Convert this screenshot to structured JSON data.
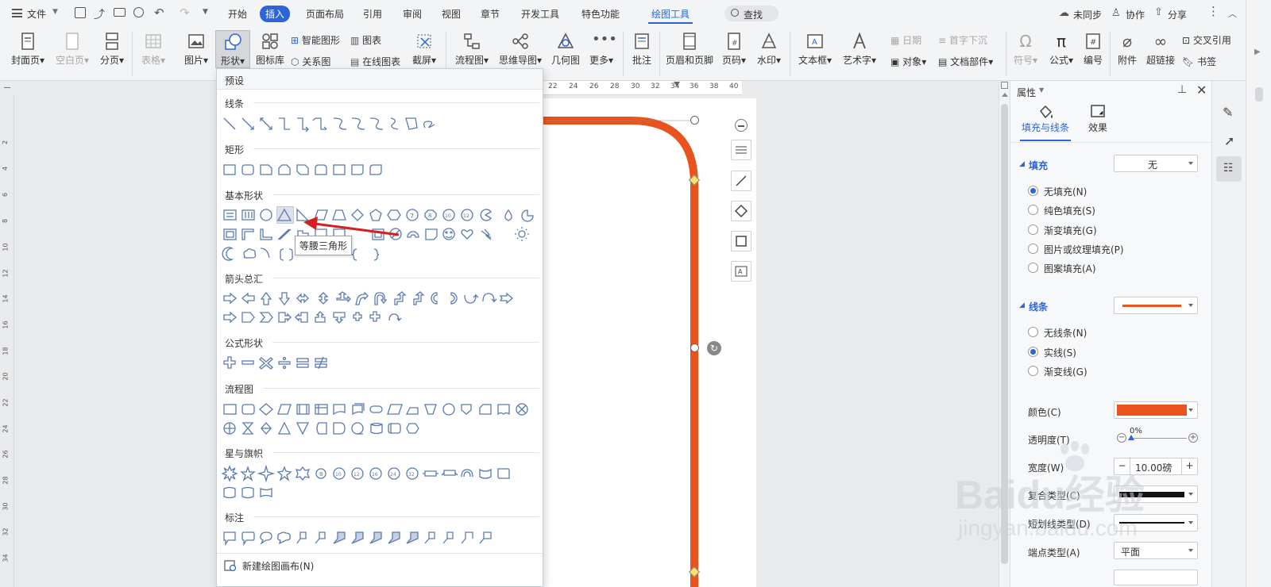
{
  "menubar": {
    "file": "文件",
    "tabs": [
      "开始",
      "插入",
      "页面布局",
      "引用",
      "审阅",
      "视图",
      "章节",
      "开发工具",
      "特色功能",
      "绘图工具"
    ],
    "active_tab": "插入",
    "search": "查找",
    "sync": "未同步",
    "collab": "协作",
    "share": "分享"
  },
  "ribbon": {
    "cover": "封面页",
    "blank": "空白页",
    "pagebreak": "分页",
    "table": "表格",
    "picture": "图片",
    "shape": "形状",
    "iconlib": "图标库",
    "smartart": "智能图形",
    "chart": "图表",
    "relation": "关系图",
    "onlinechart": "在线图表",
    "screenshot": "截屏",
    "flowchart": "流程图",
    "mindmap": "思维导图",
    "geometry": "几何图",
    "more": "更多",
    "comment": "批注",
    "headerfooter": "页眉和页脚",
    "pagenum": "页码",
    "watermark": "水印",
    "textbox": "文本框",
    "wordart": "艺术字",
    "date": "日期",
    "dropcap": "首字下沉",
    "object": "对象",
    "docparts": "文档部件",
    "symbol": "符号",
    "formula": "公式",
    "numbering": "编号",
    "attachment": "附件",
    "hyperlink": "超链接",
    "crossref": "交叉引用",
    "bookmark": "书签"
  },
  "ruler": {
    "ticks": [
      "22",
      "24",
      "26",
      "28",
      "30",
      "32",
      "34",
      "36",
      "38",
      "40"
    ],
    "left_ticks": [
      "2",
      "4",
      "6",
      "8",
      "10",
      "12",
      "14",
      "16",
      "18",
      "20",
      "22",
      "24",
      "26",
      "28",
      "30",
      "32",
      "34"
    ]
  },
  "dropdown": {
    "header": "预设",
    "sections": [
      "线条",
      "矩形",
      "基本形状",
      "箭头总汇",
      "公式形状",
      "流程图",
      "星与旗帜",
      "标注"
    ],
    "tooltip": "等腰三角形",
    "new_canvas": "新建绘图画布(N)"
  },
  "panel": {
    "title": "属性",
    "tab_fill": "填充与线条",
    "tab_effect": "效果",
    "fill_label": "填充",
    "fill_value": "无",
    "fill_options": [
      "无填充(N)",
      "纯色填充(S)",
      "渐变填充(G)",
      "图片或纹理填充(P)",
      "图案填充(A)"
    ],
    "line_label": "线条",
    "line_options": [
      "无线条(N)",
      "实线(S)",
      "渐变线(G)"
    ],
    "color_label": "颜色(C)",
    "line_color": "#e8531e",
    "transparency_label": "透明度(T)",
    "transparency_value": "0%",
    "width_label": "宽度(W)",
    "width_value": "10.00磅",
    "compound_label": "复合类型(C)",
    "dash_label": "短划线类型(D)",
    "cap_label": "端点类型(A)",
    "cap_value": "平面"
  },
  "watermark": {
    "brand": "Baidu经验",
    "url": "jingyan.baidu.com"
  }
}
